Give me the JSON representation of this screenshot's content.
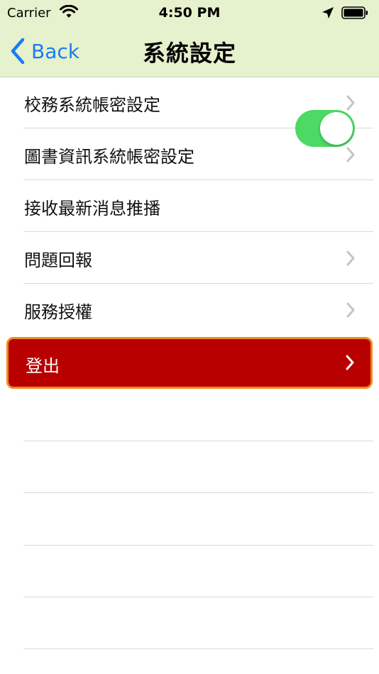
{
  "status_bar": {
    "carrier": "Carrier",
    "time": "4:50 PM"
  },
  "nav": {
    "back_label": "Back",
    "title": "系統設定"
  },
  "settings": [
    {
      "label": "校務系統帳密設定",
      "type": "disclosure"
    },
    {
      "label": "圖書資訊系統帳密設定",
      "type": "disclosure"
    },
    {
      "label": "接收最新消息推播",
      "type": "toggle",
      "on": true
    },
    {
      "label": "問題回報",
      "type": "disclosure"
    },
    {
      "label": "服務授權",
      "type": "disclosure"
    }
  ],
  "logout": {
    "label": "登出"
  },
  "colors": {
    "nav_background": "#e6f1cd",
    "accent_blue": "#1a7cf5",
    "toggle_on": "#4cd964",
    "logout_background": "#b80000",
    "logout_border": "#f08a1c"
  },
  "icons": [
    "wifi-icon",
    "location-arrow-icon",
    "battery-icon",
    "chevron-left-icon",
    "chevron-right-icon"
  ]
}
